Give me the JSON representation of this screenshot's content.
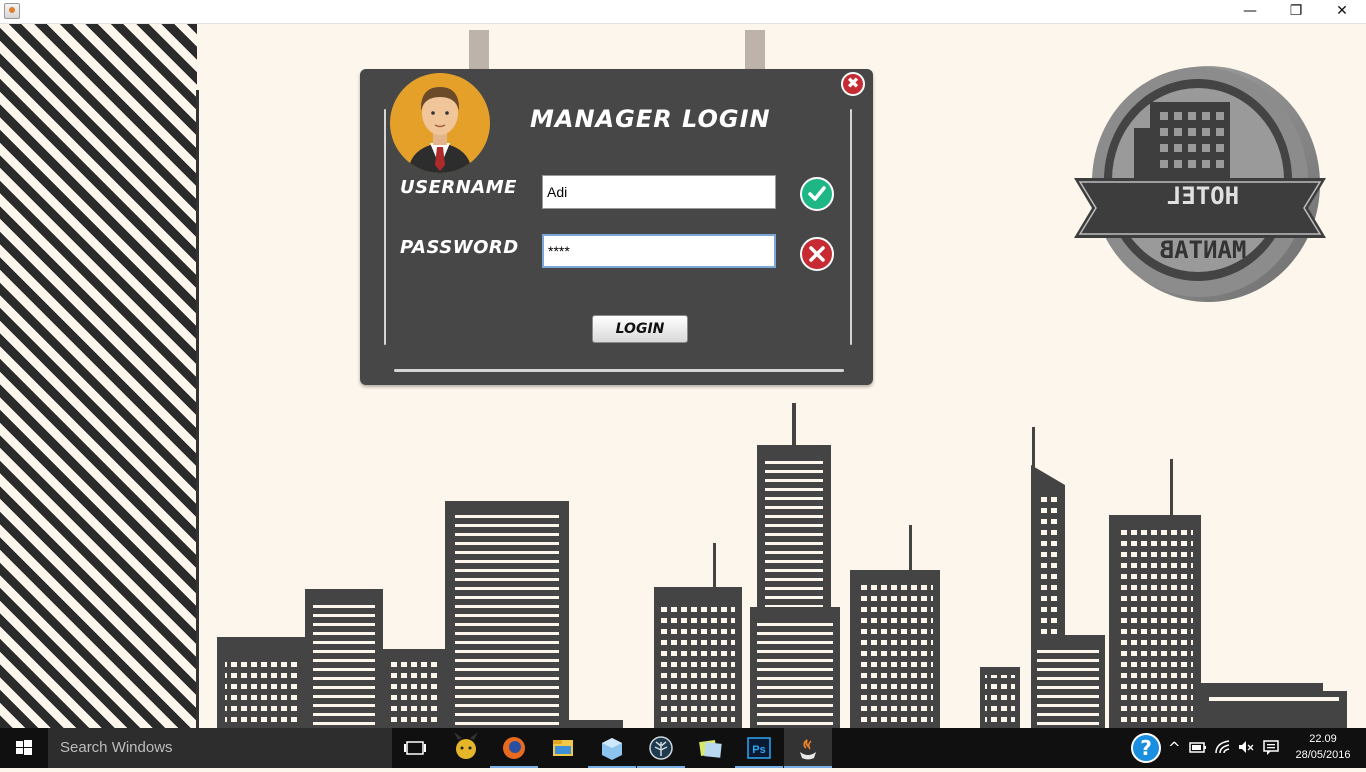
{
  "window": {
    "minimize_glyph": "—",
    "restore_glyph": "❐",
    "close_glyph": "✕"
  },
  "dialog": {
    "title": "MANAGER LOGIN",
    "username_label": "USERNAME",
    "password_label": "PASSWORD",
    "username_value": "Adi",
    "password_value": "****",
    "login_label": "LOGIN",
    "username_status": "valid",
    "password_status": "invalid",
    "close_glyph": "✖"
  },
  "logo": {
    "line1": "HOTEL",
    "line2": "MANTAB"
  },
  "taskbar": {
    "search_placeholder": "Search Windows",
    "time": "22.09",
    "date": "28/05/2016",
    "apps": [
      {
        "name": "task-view-icon"
      },
      {
        "name": "pikachu-app-icon"
      },
      {
        "name": "firefox-icon"
      },
      {
        "name": "file-explorer-icon"
      },
      {
        "name": "box-app-icon"
      },
      {
        "name": "tree-app-icon"
      },
      {
        "name": "sticky-notes-icon"
      },
      {
        "name": "photoshop-icon",
        "label": "Ps"
      },
      {
        "name": "java-icon"
      }
    ],
    "help_glyph": "?",
    "chevron_glyph": "^"
  },
  "colors": {
    "background": "#fdf6ec",
    "dialog": "#474747",
    "building": "#444444",
    "ok": "#1fb685",
    "error": "#c62b33"
  }
}
